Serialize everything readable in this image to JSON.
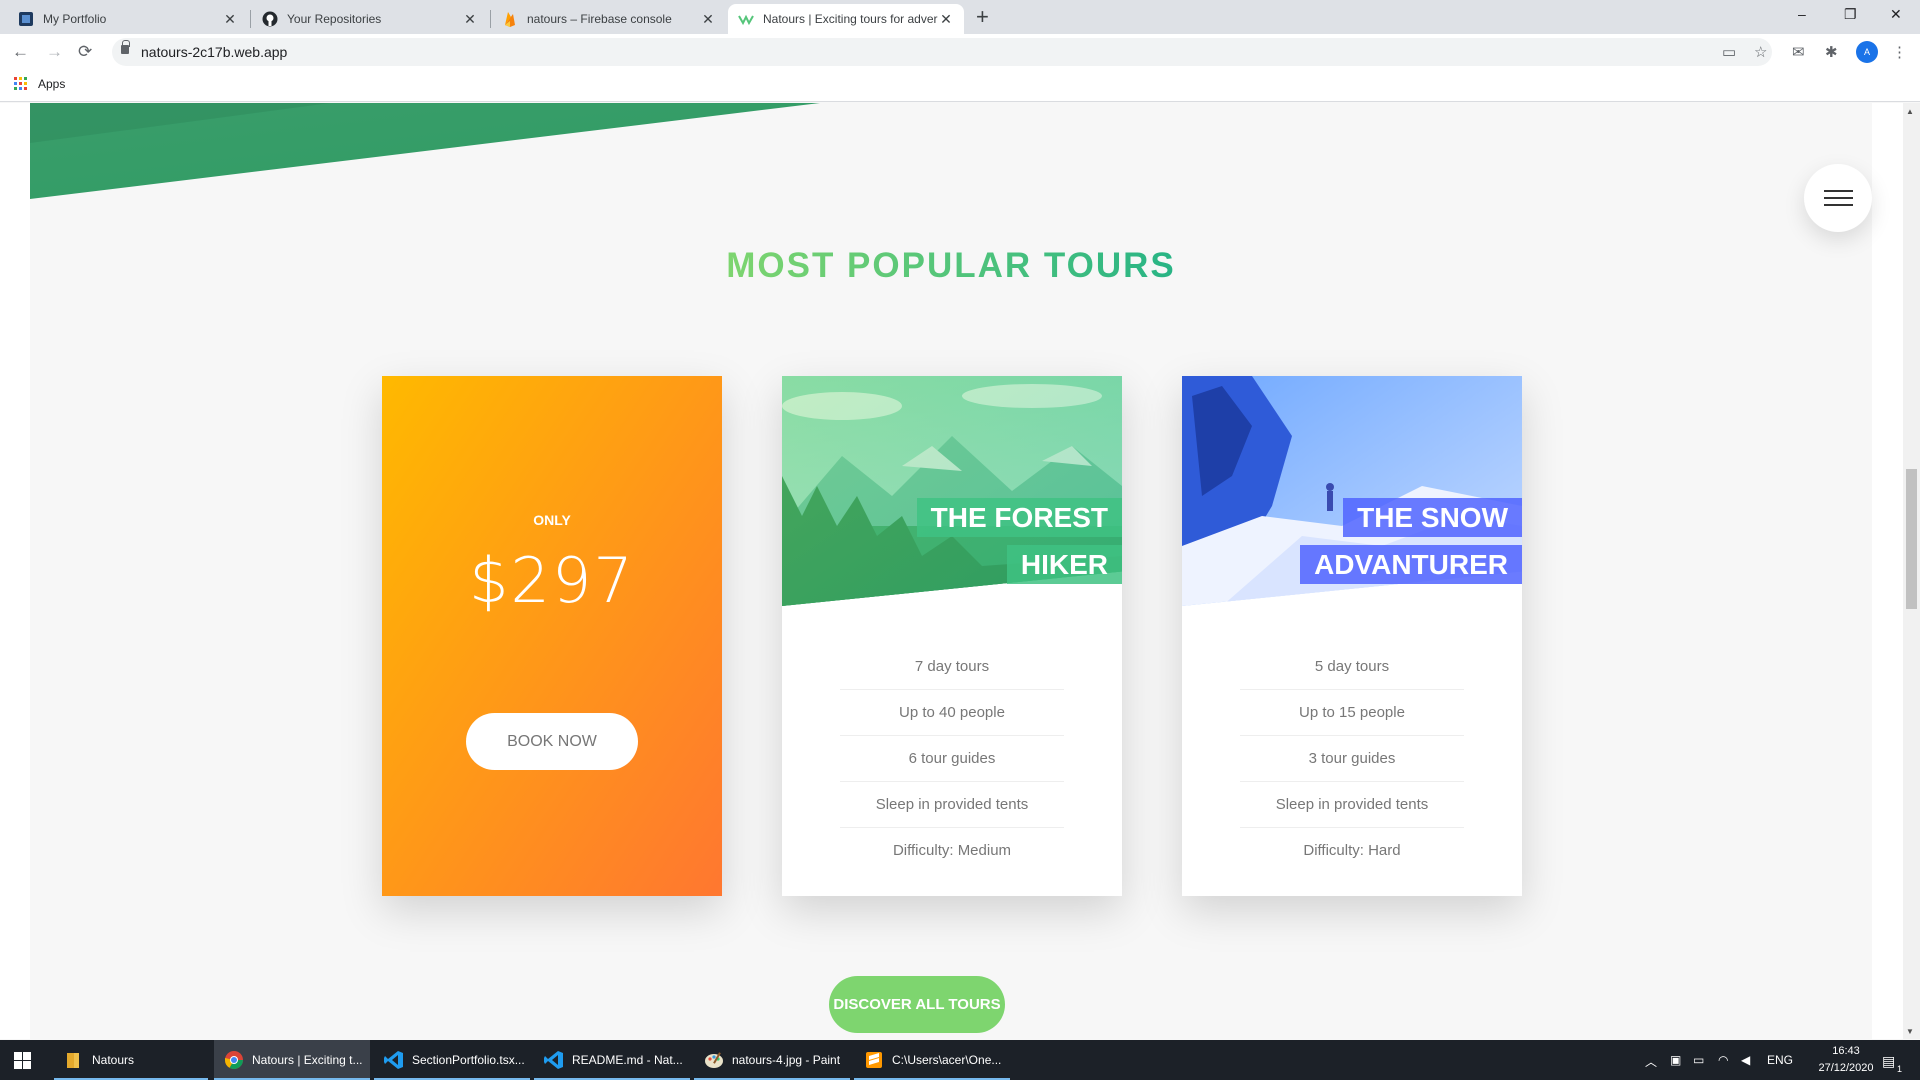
{
  "browser": {
    "tabs": [
      {
        "title": "My Portfolio",
        "active": false
      },
      {
        "title": "Your Repositories",
        "active": false
      },
      {
        "title": "natours – Firebase console",
        "active": false
      },
      {
        "title": "Natours | Exciting tours for adver",
        "active": true
      }
    ],
    "new_tab": "+",
    "window_controls": {
      "minimize": "–",
      "restore": "❐",
      "close": "✕"
    },
    "url": "natours-2c17b.web.app",
    "bookmarks": {
      "apps_label": "Apps"
    }
  },
  "page": {
    "section_title": "MOST POPULAR TOURS",
    "price_card": {
      "only_label": "ONLY",
      "price": "$297",
      "button": "BOOK NOW"
    },
    "tours": [
      {
        "heading_lines": [
          "THE FOREST",
          "HIKER"
        ],
        "details": [
          "7 day tours",
          "Up to 40 people",
          "6 tour guides",
          "Sleep in provided tents",
          "Difficulty: Medium"
        ]
      },
      {
        "heading_lines": [
          "THE SNOW",
          "ADVANTURER"
        ],
        "details": [
          "5 day tours",
          "Up to 15 people",
          "3 tour guides",
          "Sleep in provided tents",
          "Difficulty: Hard"
        ]
      }
    ],
    "discover_button": "DISCOVER ALL TOURS"
  },
  "taskbar": {
    "items": [
      {
        "label": "Natours",
        "icon": "folder-icon"
      },
      {
        "label": "Natours | Exciting t...",
        "icon": "chrome-icon",
        "active": true
      },
      {
        "label": "SectionPortfolio.tsx...",
        "icon": "vscode-icon"
      },
      {
        "label": "README.md - Nat...",
        "icon": "vscode-icon"
      },
      {
        "label": "natours-4.jpg - Paint",
        "icon": "paint-icon"
      },
      {
        "label": "C:\\Users\\acer\\One...",
        "icon": "sublime-icon"
      }
    ],
    "language": "ENG",
    "time": "16:43",
    "date": "27/12/2020",
    "notification_count": "1"
  },
  "colors": {
    "primary_green": "#7ed56f",
    "dark_green": "#28b485",
    "orange_light": "#ffb900",
    "orange_dark": "#ff7730",
    "blue": "#5064ff"
  }
}
